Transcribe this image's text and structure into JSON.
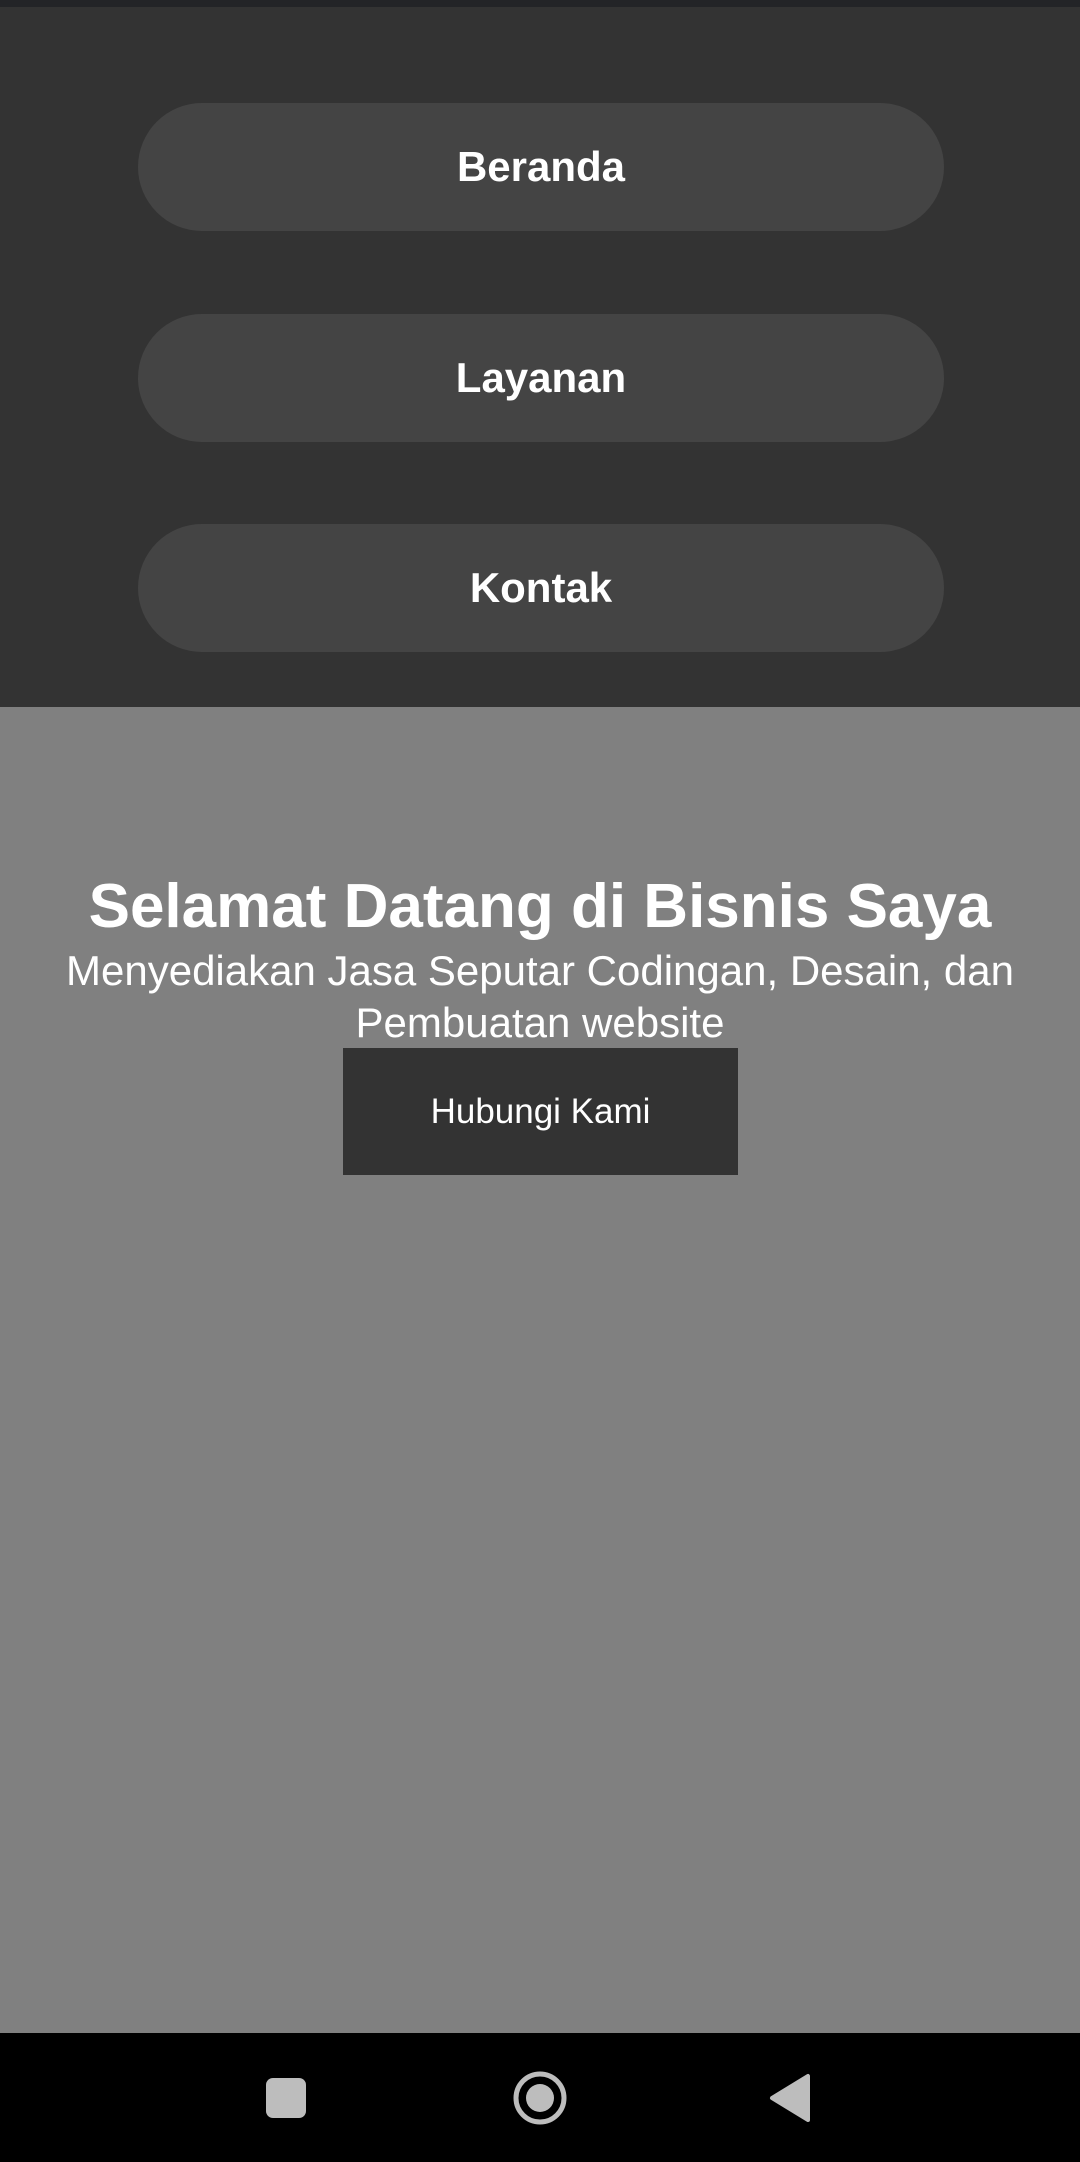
{
  "nav": {
    "items": [
      {
        "label": "Beranda"
      },
      {
        "label": "Layanan"
      },
      {
        "label": "Kontak"
      }
    ]
  },
  "hero": {
    "title": "Selamat Datang di Bisnis Saya",
    "subtitle": "Menyediakan Jasa Seputar Codingan, Desain, dan Pembuatan website",
    "cta_label": "Hubungi Kami"
  },
  "system_nav": {
    "recents_icon": "square-icon",
    "home_icon": "circle-icon",
    "back_icon": "triangle-back-icon"
  },
  "colors": {
    "nav_bg": "#333333",
    "nav_button_bg": "#444444",
    "hero_bg": "#808080",
    "cta_bg": "#333333",
    "text": "#ffffff"
  }
}
